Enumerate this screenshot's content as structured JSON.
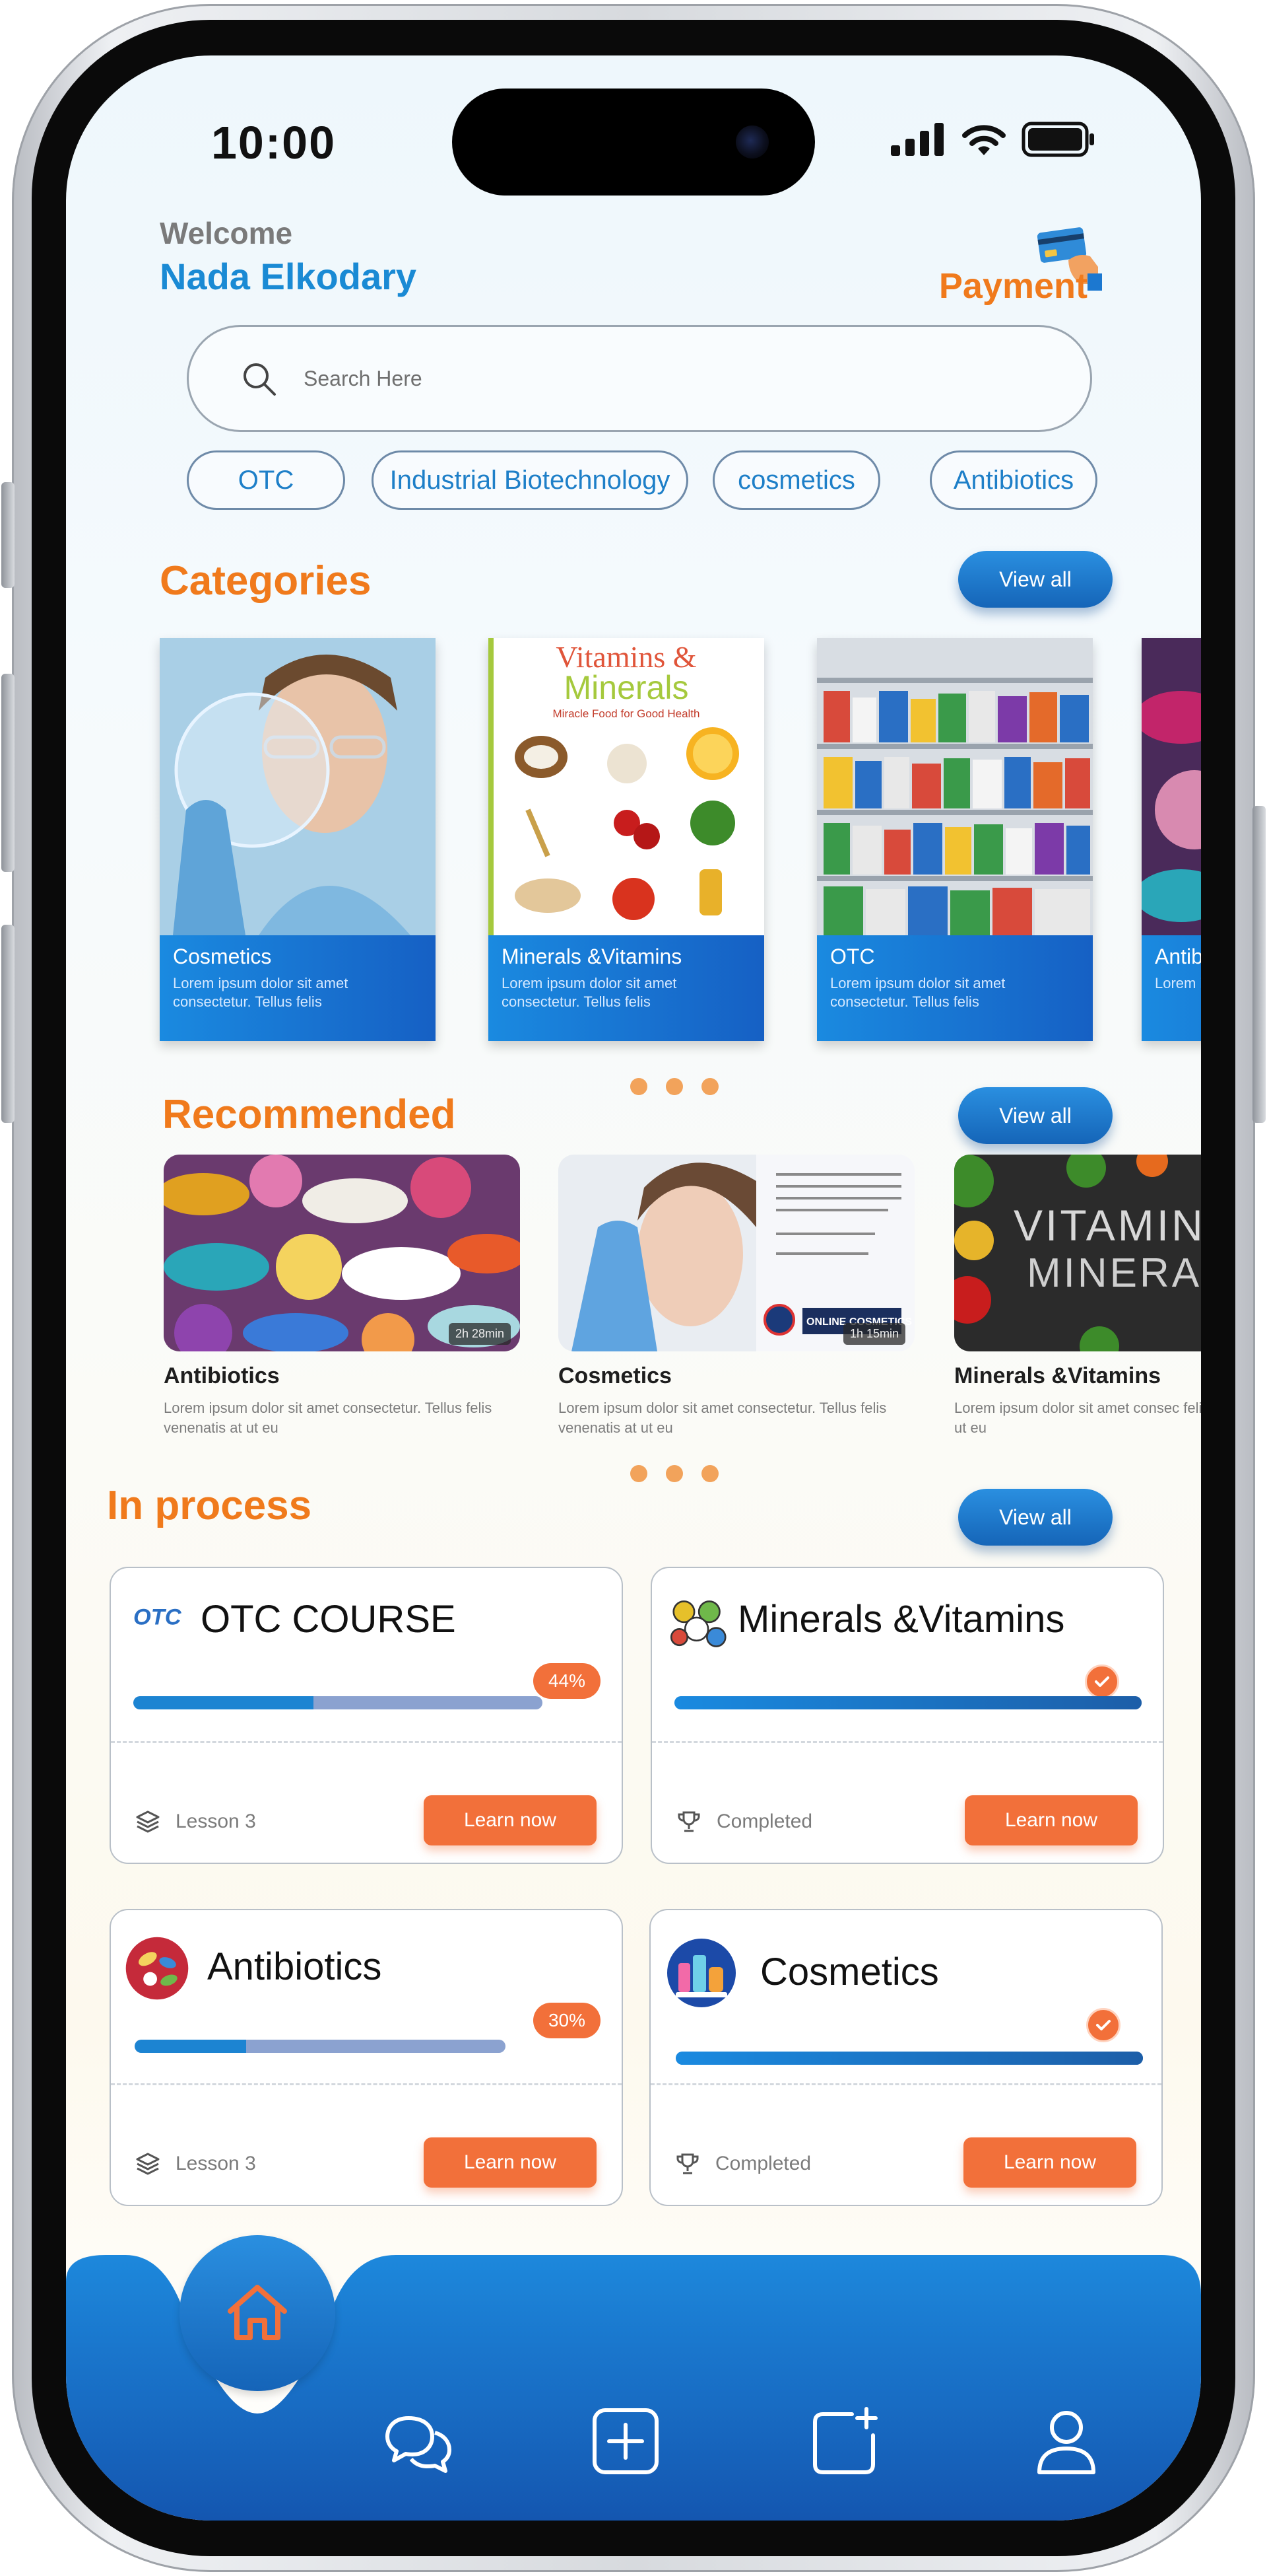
{
  "status_bar": {
    "time": "10:00"
  },
  "header": {
    "welcome": "Welcome",
    "user_name": "Nada Elkodary",
    "payment_label": "Payment"
  },
  "search": {
    "placeholder": "Search Here"
  },
  "chips": [
    "OTC",
    "Industrial Biotechnology",
    "cosmetics",
    "Antibiotics"
  ],
  "categories": {
    "title": "Categories",
    "view_all": "View all",
    "items": [
      {
        "title": "Cosmetics",
        "desc": "Lorem ipsum dolor sit amet consectetur. Tellus felis"
      },
      {
        "title": "Minerals &Vitamins",
        "desc": "Lorem ipsum dolor sit amet consectetur. Tellus felis",
        "image_text": {
          "line1": "Vitamins &",
          "line2": "Minerals",
          "line3": "Miracle Food for Good Health"
        }
      },
      {
        "title": "OTC",
        "desc": "Lorem ipsum dolor sit amet consectetur. Tellus felis"
      },
      {
        "title": "Antib",
        "desc": "Lorem i amet c"
      }
    ]
  },
  "recommended": {
    "title": "Recommended",
    "view_all": "View all",
    "items": [
      {
        "title": "Antibiotics",
        "desc": "Lorem ipsum dolor sit amet consectetur. Tellus felis venenatis at ut eu",
        "duration": "2h 28min"
      },
      {
        "title": "Cosmetics",
        "desc": "Lorem ipsum dolor sit amet consectetur. Tellus felis venenatis at ut eu",
        "duration": "1h 15min",
        "image_text": "ONLINE COSMETICS"
      },
      {
        "title": "Minerals &Vitamins",
        "desc": "Lorem ipsum dolor sit amet consec felis venenatis at ut eu",
        "image_text": {
          "line1": "VITAMINS",
          "line2": "MINERAL"
        }
      }
    ]
  },
  "in_process": {
    "title": "In process",
    "view_all": "View all",
    "items": [
      {
        "title": "OTC COURSE",
        "icon": "otc-logo-icon",
        "progress": 0.44,
        "progress_label": "44%",
        "status": "Lesson 3",
        "status_icon": "layers-icon",
        "button": "Learn now",
        "icon_text": "OTC"
      },
      {
        "title": "Minerals &Vitamins",
        "icon": "minerals-icon",
        "progress": 1.0,
        "status": "Completed",
        "status_icon": "trophy-icon",
        "button": "Learn now"
      },
      {
        "title": "Antibiotics",
        "icon": "antibiotics-icon",
        "progress": 0.3,
        "progress_label": "30%",
        "status": "Lesson 3",
        "status_icon": "layers-icon",
        "button": "Learn now"
      },
      {
        "title": "Cosmetics",
        "icon": "cosmetics-icon",
        "progress": 1.0,
        "status": "Completed",
        "status_icon": "trophy-icon",
        "button": "Learn now"
      }
    ]
  },
  "bottom_nav": [
    "home-icon",
    "chat-icon",
    "add-square-icon",
    "new-post-icon",
    "profile-icon"
  ],
  "colors": {
    "accent_orange": "#f07a1c",
    "primary_blue": "#1a8ad4",
    "button_orange": "#f2703a",
    "nav_blue": "#1c78d0"
  }
}
